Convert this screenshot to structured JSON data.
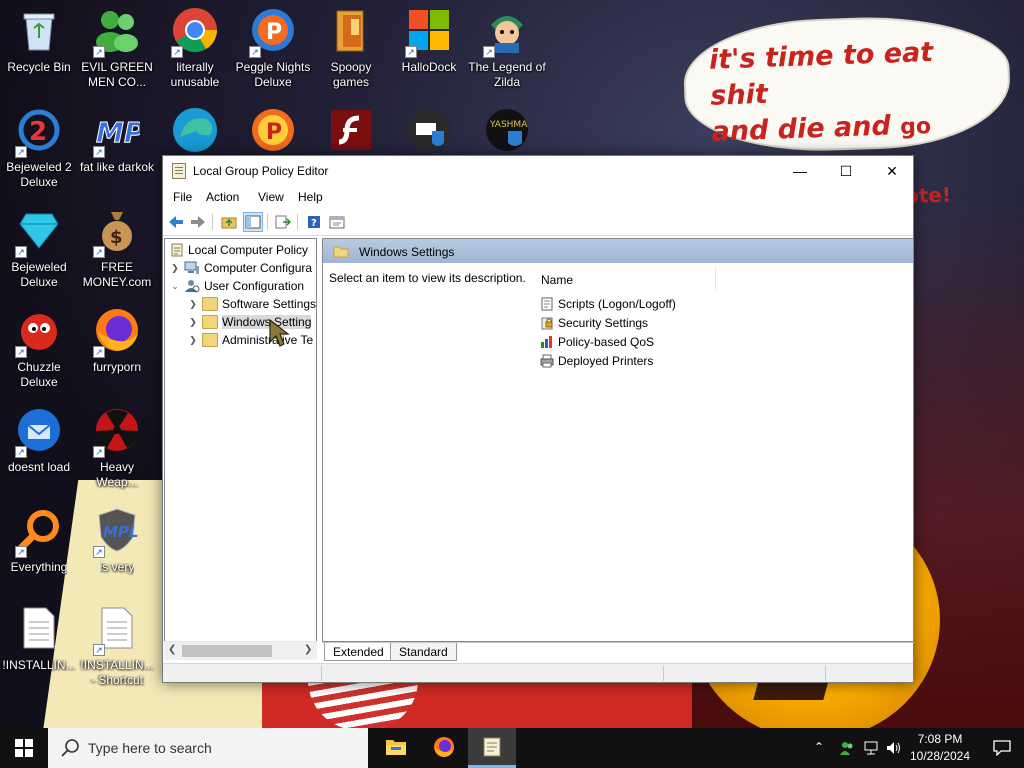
{
  "desktop": {
    "speech_bubble": {
      "line1": "it's time to eat shit",
      "line2a": "and die and ",
      "line2b": "go trick",
      "line3": "or treating and vote!"
    },
    "icons": [
      {
        "label": "Recycle Bin",
        "icon": "recycle-bin-icon"
      },
      {
        "label": "EVIL GREEN MEN CO...",
        "icon": "green-men-icon"
      },
      {
        "label": "literally unusable",
        "icon": "chrome-icon"
      },
      {
        "label": "Peggle Nights Deluxe",
        "icon": "peggle-icon"
      },
      {
        "label": "Spoopy games",
        "icon": "folder-icon"
      },
      {
        "label": "HalloDock",
        "icon": "windows-logo-icon"
      },
      {
        "label": "The Legend of Zilda",
        "icon": "character-icon"
      },
      {
        "label": "Bejeweled 2 Deluxe",
        "icon": "bejeweled2-icon"
      },
      {
        "label": "fat like darkok",
        "icon": "mpl-icon"
      },
      {
        "label": "Bejeweled Deluxe",
        "icon": "diamond-icon"
      },
      {
        "label": "FREE MONEY.com",
        "icon": "money-bag-icon"
      },
      {
        "label": "Chuzzle Deluxe",
        "icon": "chuzzle-icon"
      },
      {
        "label": "furryporn",
        "icon": "firefox-icon"
      },
      {
        "label": "doesnt load",
        "icon": "thunderbird-icon"
      },
      {
        "label": "Heavy Weap...",
        "icon": "radiation-icon"
      },
      {
        "label": "Everything",
        "icon": "magnifier-icon"
      },
      {
        "label": "is very",
        "icon": "shield-icon"
      },
      {
        "label": "!INSTALLIN...",
        "icon": "document-icon"
      },
      {
        "label": "!INSTALLIN... - Shortcut",
        "icon": "document-icon"
      },
      {
        "label": "YASHMA",
        "icon": "yashma-icon"
      }
    ]
  },
  "window": {
    "title": "Local Group Policy Editor",
    "controls": {
      "minimize": "—",
      "maximize": "☐",
      "close": "✕"
    },
    "menu": [
      "File",
      "Action",
      "View",
      "Help"
    ],
    "tree": {
      "root": "Local Computer Policy",
      "computer_config": "Computer Configura",
      "user_config": "User Configuration",
      "software_settings": "Software Settings",
      "windows_settings": "Windows Setting",
      "admin_templates": "Administrative Te"
    },
    "detail": {
      "header": "Windows Settings",
      "description": "Select an item to view its description.",
      "column_name": "Name",
      "items": [
        "Scripts (Logon/Logoff)",
        "Security Settings",
        "Policy-based QoS",
        "Deployed Printers"
      ]
    },
    "tabs": [
      "Extended",
      "Standard"
    ]
  },
  "taskbar": {
    "search_placeholder": "Type here to search",
    "time": "7:08 PM",
    "date": "10/28/2024"
  },
  "colors": {
    "accent": "#0078d7",
    "detail_header": "#a8bfda",
    "bubble_text": "#c8231d"
  }
}
